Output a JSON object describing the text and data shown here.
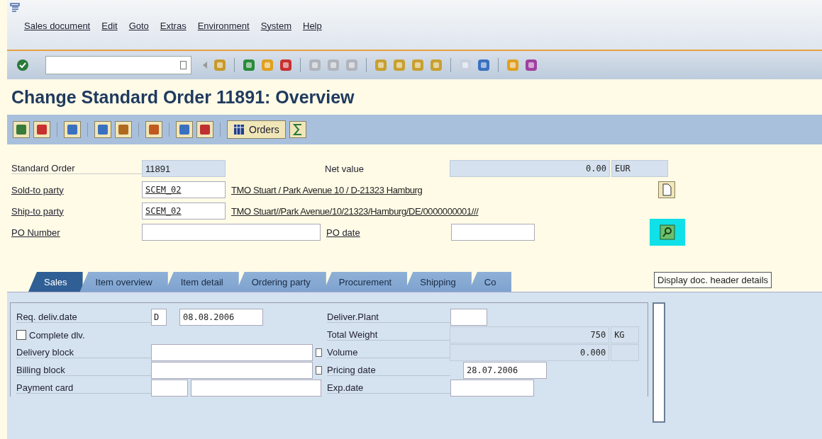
{
  "menu": [
    "Sales document",
    "Edit",
    "Goto",
    "Extras",
    "Environment",
    "System",
    "Help"
  ],
  "title": "Change Standard Order 11891: Overview",
  "app_toolbar": {
    "orders_button": "Orders"
  },
  "header": {
    "order": {
      "label": "Standard Order",
      "value": "11891"
    },
    "net_value": {
      "label": "Net value",
      "value": "0.00",
      "currency": "EUR"
    },
    "sold_to": {
      "label": "Sold-to party",
      "value": "SCEM_02",
      "address": "TMO Stuart / Park Avenue 10 / D-21323 Hamburg"
    },
    "ship_to": {
      "label": "Ship-to party",
      "value": "SCEM_02",
      "address": "TMO Stuart//Park Avenue/10/21323/Hamburg/DE/0000000001///"
    },
    "po_number": {
      "label": "PO Number"
    },
    "po_date": {
      "label": "PO date"
    }
  },
  "tooltip": "Display doc. header details",
  "tabs": [
    {
      "label": "Sales",
      "selected": true
    },
    {
      "label": "Item overview",
      "selected": false
    },
    {
      "label": "Item detail",
      "selected": false
    },
    {
      "label": "Ordering party",
      "selected": false
    },
    {
      "label": "Procurement",
      "selected": false
    },
    {
      "label": "Shipping",
      "selected": false
    },
    {
      "label": "Co",
      "selected": false
    }
  ],
  "sales": {
    "req_deliv_date": {
      "label": "Req. deliv.date",
      "unit": "D",
      "value": "08.08.2006"
    },
    "complete_dlv": {
      "label": "Complete dlv.",
      "checked": false
    },
    "delivery_block": {
      "label": "Delivery block"
    },
    "billing_block": {
      "label": "Billing block"
    },
    "payment_card": {
      "label": "Payment card"
    },
    "deliver_plant": {
      "label": "Deliver.Plant"
    },
    "total_weight": {
      "label": "Total Weight",
      "value": "750",
      "unit": "KG"
    },
    "volume": {
      "label": "Volume",
      "value": "0.000"
    },
    "pricing_date": {
      "label": "Pricing date",
      "value": "28.07.2006"
    },
    "exp_date": {
      "label": "Exp.date"
    }
  }
}
